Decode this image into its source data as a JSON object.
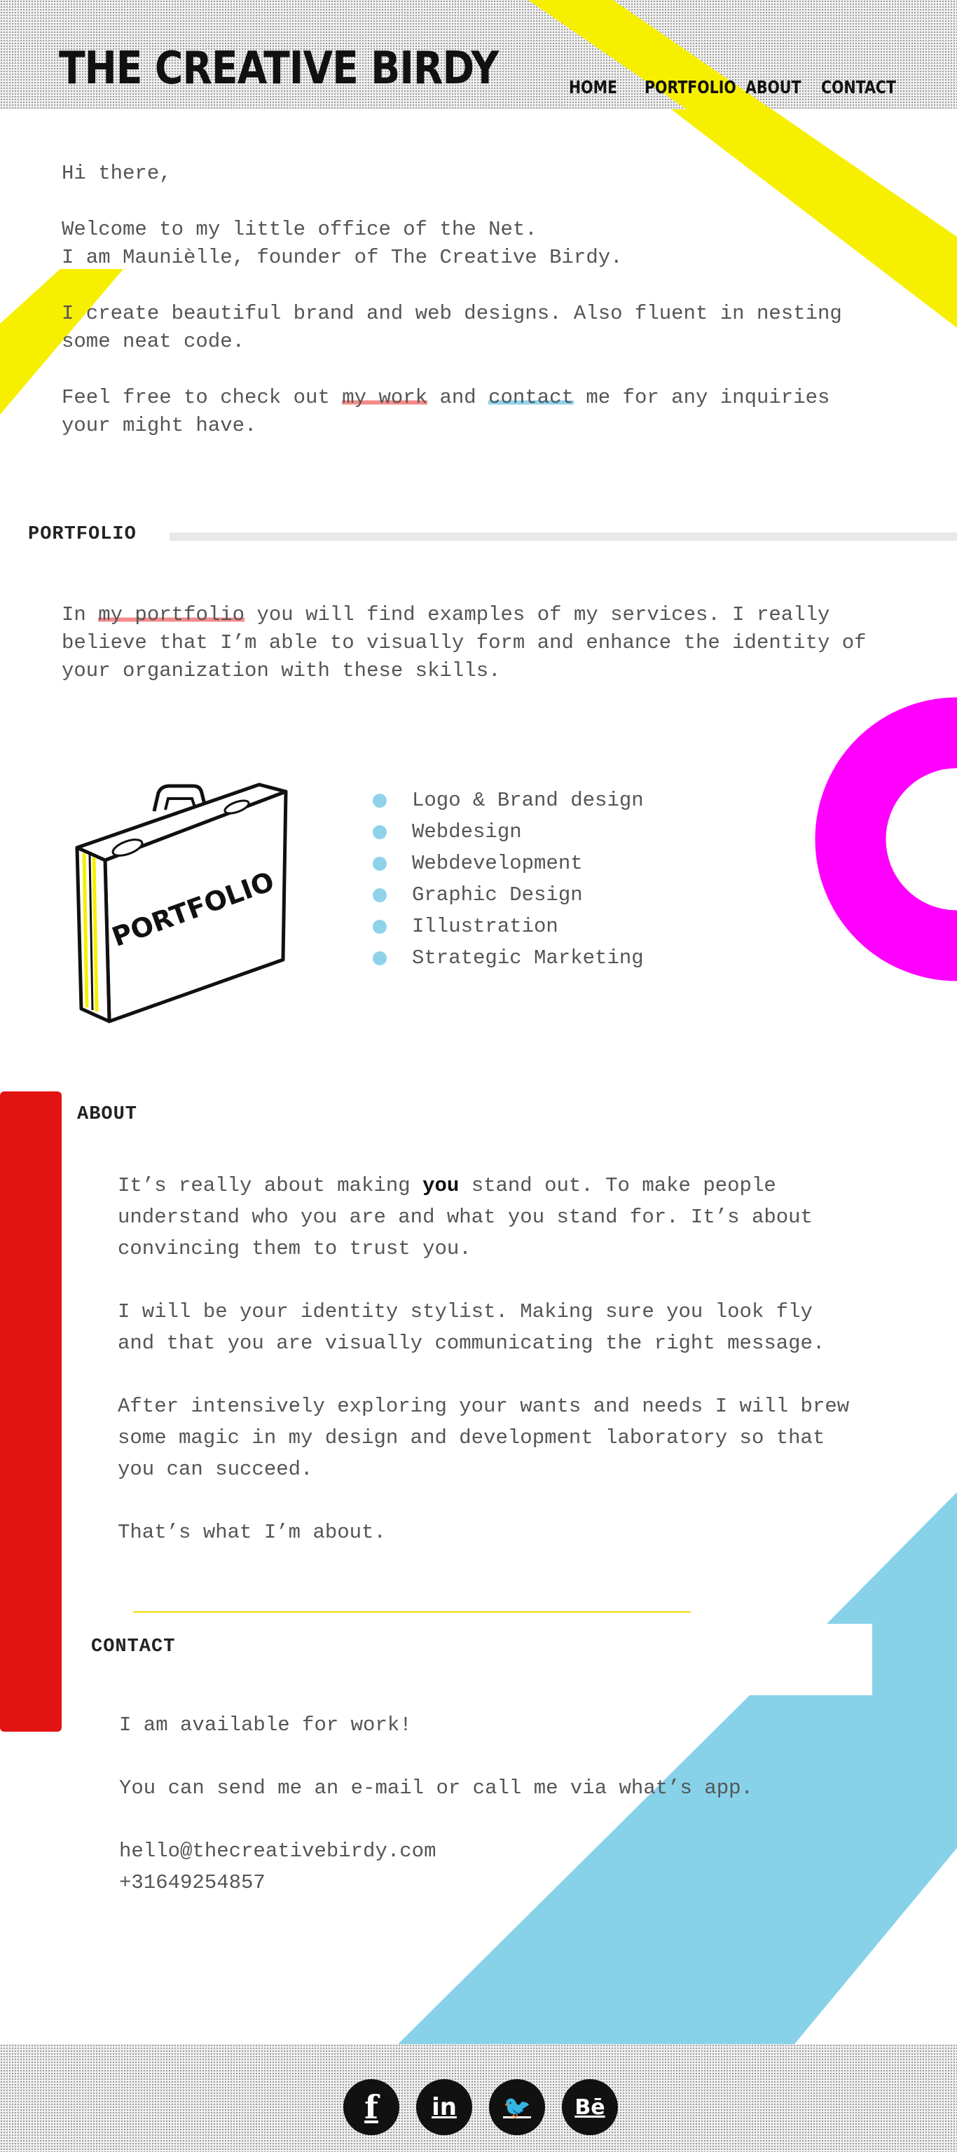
{
  "header": {
    "logo": "THE CREATIVE BIRDY",
    "nav": [
      {
        "label": "HOME"
      },
      {
        "label": "PORTFOLIO"
      },
      {
        "label": "ABOUT"
      },
      {
        "label": "CONTACT"
      }
    ]
  },
  "intro": {
    "greeting": "Hi there,",
    "welcome_line1": "Welcome to my little office of the Net.",
    "welcome_line2": "I am Maunièlle, founder of The Creative Birdy.",
    "create_text": "I create beautiful brand and web designs. Also fluent in nesting some neat code.",
    "cta_before": "Feel free to check out ",
    "cta_work_link": "my work",
    "cta_middle": " and ",
    "cta_contact_link": "contact",
    "cta_after": " me for any inquiries your might have."
  },
  "portfolio": {
    "title": "PORTFOLIO",
    "text_before": "In ",
    "text_link": "my portfolio",
    "text_after": " you will find examples of my services. I really believe that I’m able to visually form and enhance the identity of your organization with these skills.",
    "briefcase_label": "PORTFOLIO",
    "services": [
      "Logo & Brand design",
      "Webdesign",
      "Webdevelopment",
      "Graphic Design",
      "Illustration",
      "Strategic Marketing"
    ]
  },
  "about": {
    "title": "ABOUT",
    "p1_before": "It’s really about making ",
    "p1_bold": "you",
    "p1_after": " stand out. To make people understand who you are and what you stand for. It’s about convincing them to trust you.",
    "p2": "I will be your identity stylist. Making sure you look fly and that you are visually communicating the right message.",
    "p3": "After intensively exploring your wants and needs I will brew some magic in my design and development laboratory so that you can succeed.",
    "p4": "That’s what I’m about."
  },
  "contact": {
    "title": "CONTACT",
    "p1": "I am available for work!",
    "p2": "You can send me an e-mail or call me via what’s app.",
    "email": "hello@thecreativebirdy.com",
    "phone": "+31649254857"
  },
  "footer": {
    "social": [
      {
        "icon": "facebook-icon",
        "glyph": "f"
      },
      {
        "icon": "linkedin-icon",
        "glyph": "in"
      },
      {
        "icon": "twitter-icon",
        "glyph": "🐦"
      },
      {
        "icon": "behance-icon",
        "glyph": "Bē"
      }
    ]
  },
  "colors": {
    "yellow": "#f7ef00",
    "magenta": "#ff00ff",
    "red": "#e31313",
    "light_blue": "#87d2e9"
  }
}
